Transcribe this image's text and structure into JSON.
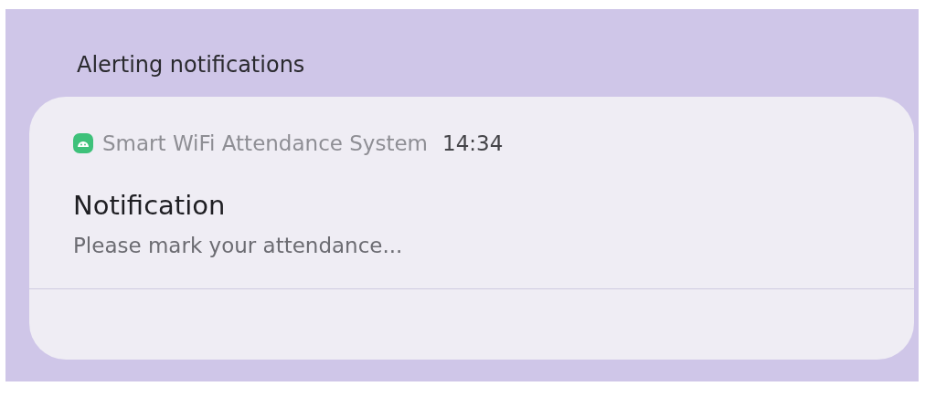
{
  "section_title": "Alerting notifications",
  "notification": {
    "app_name": "Smart WiFi Attendance System",
    "time": "14:34",
    "title": "Notification",
    "body": "Please mark your attendance..."
  }
}
